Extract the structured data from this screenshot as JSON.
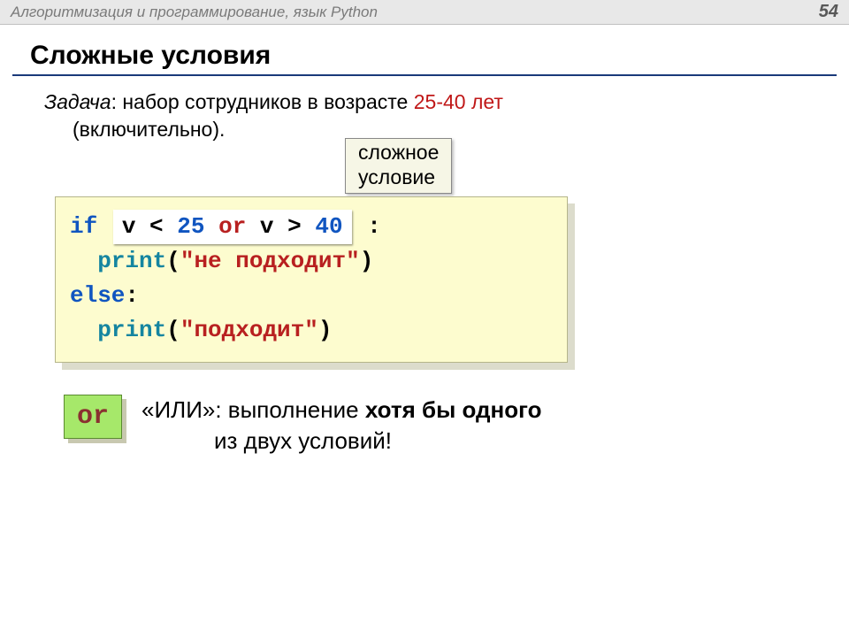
{
  "header": {
    "title": "Алгоритмизация и программирование, язык Python",
    "page": "54"
  },
  "slide": {
    "title": "Сложные условия",
    "task_label": "Задача",
    "task_text1": ": набор сотрудников в возрасте ",
    "task_range": "25-40 лет",
    "task_text2": " (включительно).",
    "callout_l1": "сложное",
    "callout_l2": "условие"
  },
  "code": {
    "if": "if",
    "cond_v1": "v",
    "cond_lt": "<",
    "cond_n1": "25",
    "cond_or": "or",
    "cond_v2": "v",
    "cond_gt": ">",
    "cond_n2": "40",
    "colon": ":",
    "print": "print",
    "str1": "\"не подходит\"",
    "else": "else",
    "str2": "\"подходит\""
  },
  "or": {
    "badge": "or",
    "line1a": "«ИЛИ»: выполнение ",
    "line1b": "хотя бы одного",
    "line2": "из двух условий!"
  }
}
